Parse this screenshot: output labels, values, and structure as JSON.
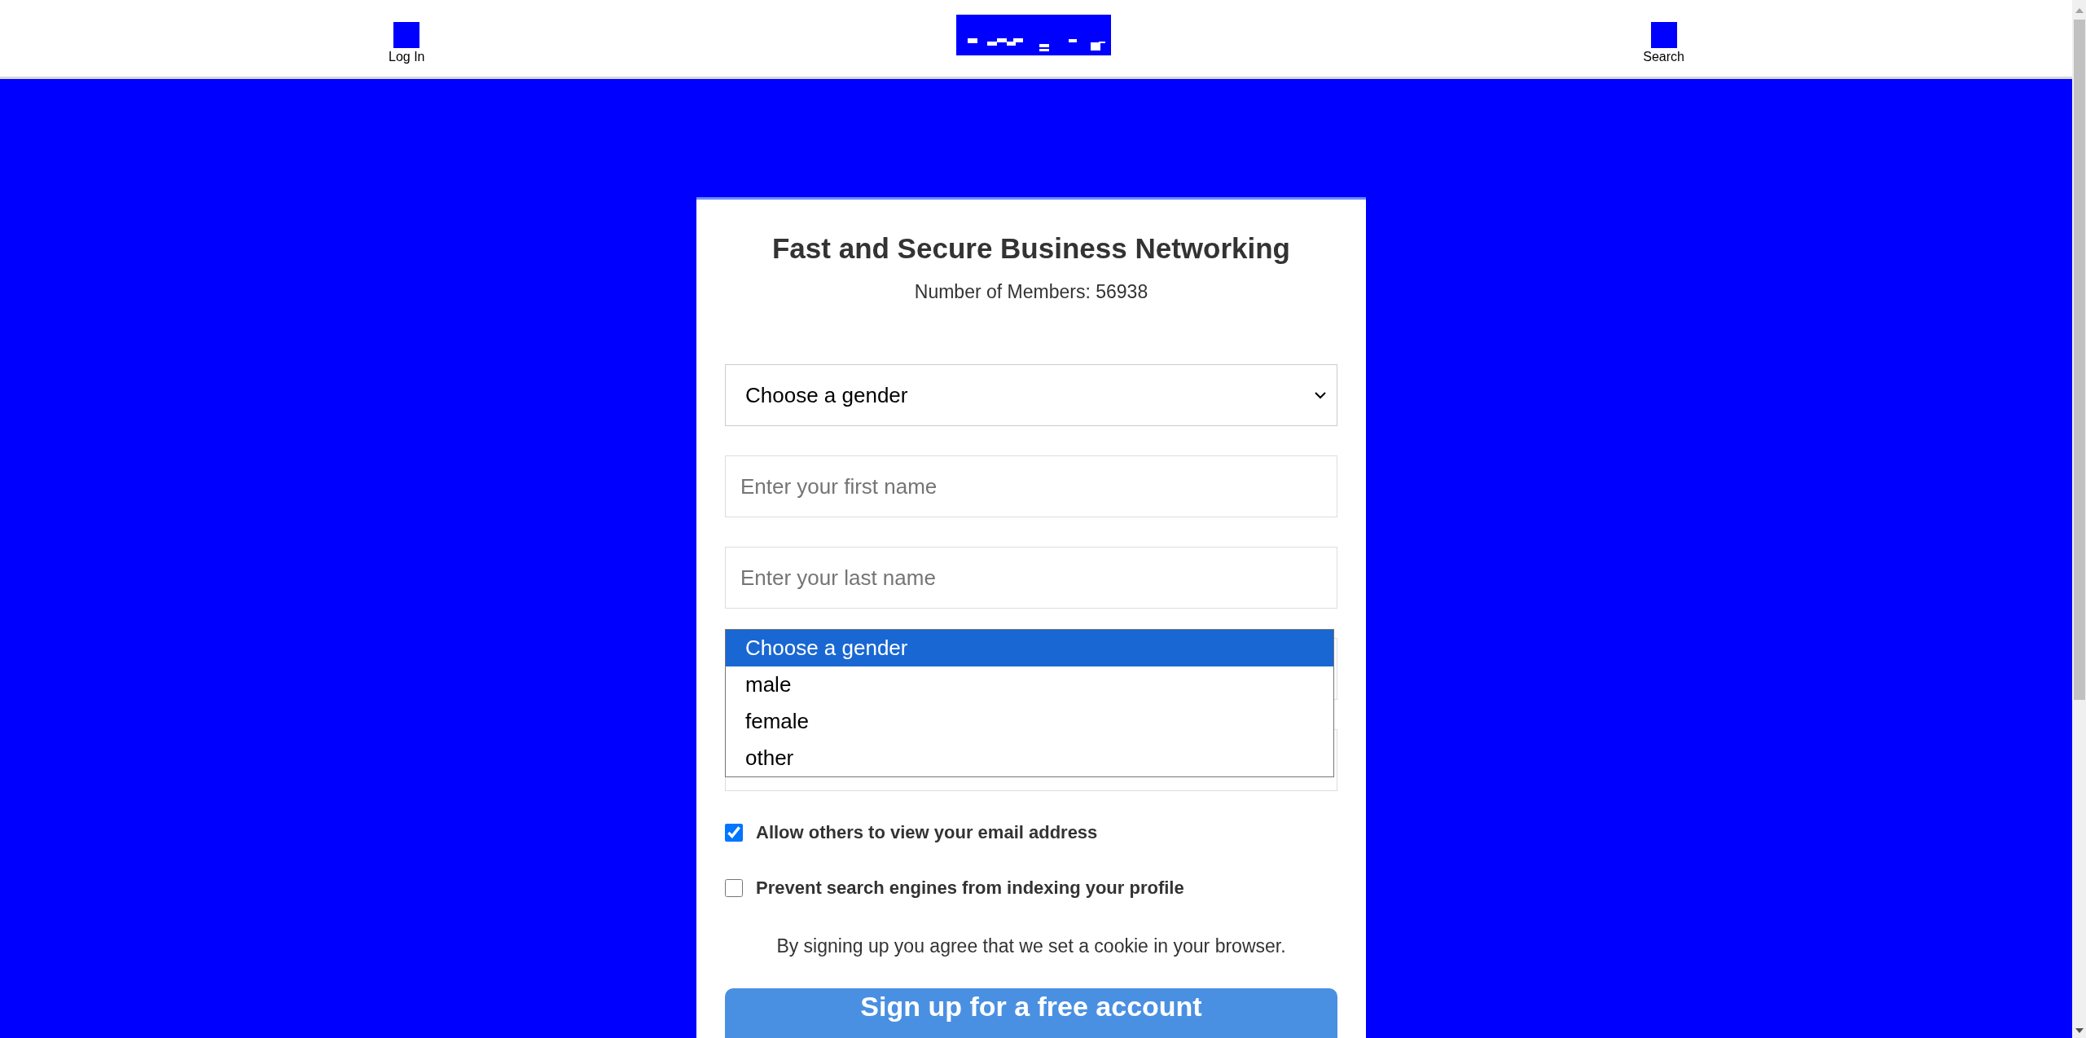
{
  "header": {
    "login": {
      "label": "Log In"
    },
    "search": {
      "label": "Search"
    }
  },
  "card": {
    "title": "Fast and Secure Business Networking",
    "members": "Number of Members: 56938"
  },
  "gender_select": {
    "value": "Choose a gender",
    "expanded": true,
    "options": [
      {
        "label": "Choose a gender",
        "selected": true
      },
      {
        "label": "male",
        "selected": false
      },
      {
        "label": "female",
        "selected": false
      },
      {
        "label": "other",
        "selected": false
      }
    ]
  },
  "fields": [
    {
      "placeholder": "Enter your first name"
    },
    {
      "placeholder": "Enter your last name"
    }
  ],
  "checkboxes": [
    {
      "label": "Allow others to view your email address",
      "checked": true
    },
    {
      "label": "Prevent search engines from indexing your profile",
      "checked": false
    }
  ],
  "notice": "By signing up you agree that we set a cookie in your browser.",
  "submit": {
    "label": "Sign up for a free account"
  }
}
